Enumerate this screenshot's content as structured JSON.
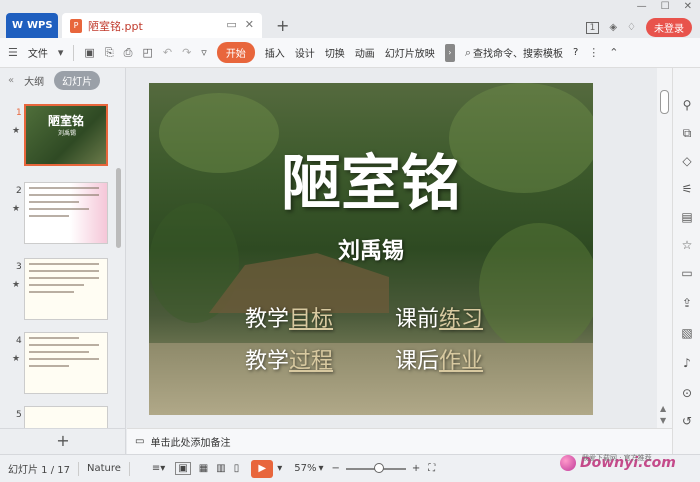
{
  "titlebar": {
    "app_tab": "WPS",
    "doc_tab": "陋室铭.ppt",
    "doc_badge": "P",
    "new_tab": "+",
    "page_badge": "1",
    "login": "未登录",
    "min": "—",
    "max": "☐",
    "close": "✕"
  },
  "ribbon": {
    "file_menu": "文件",
    "tabs": [
      "开始",
      "插入",
      "设计",
      "切换",
      "动画",
      "幻灯片放映"
    ],
    "search": "查找命令、搜索模板",
    "help": "?"
  },
  "left_panel": {
    "tab_outline": "大纲",
    "tab_slides": "幻灯片",
    "thumbnails": [
      {
        "num": "1",
        "title": "陋室铭",
        "subtitle": "刘禹锡"
      },
      {
        "num": "2"
      },
      {
        "num": "3"
      },
      {
        "num": "4"
      },
      {
        "num": "5"
      }
    ],
    "add": "+"
  },
  "slide": {
    "title": "陋室铭",
    "author": "刘禹锡",
    "items": [
      {
        "prefix": "教学",
        "highlight": "目标"
      },
      {
        "prefix": "课前",
        "highlight": "练习"
      },
      {
        "prefix": "教学",
        "highlight": "过程"
      },
      {
        "prefix": "课后",
        "highlight": "作业"
      }
    ]
  },
  "notes": {
    "placeholder": "单击此处添加备注"
  },
  "status": {
    "slide_counter": "幻灯片 1 / 17",
    "theme": "Nature",
    "zoom": "57%",
    "zoom_value": 0.57
  },
  "watermark": {
    "text": "Downyi.com",
    "small": "我爱下载网 · 官方推荐"
  }
}
